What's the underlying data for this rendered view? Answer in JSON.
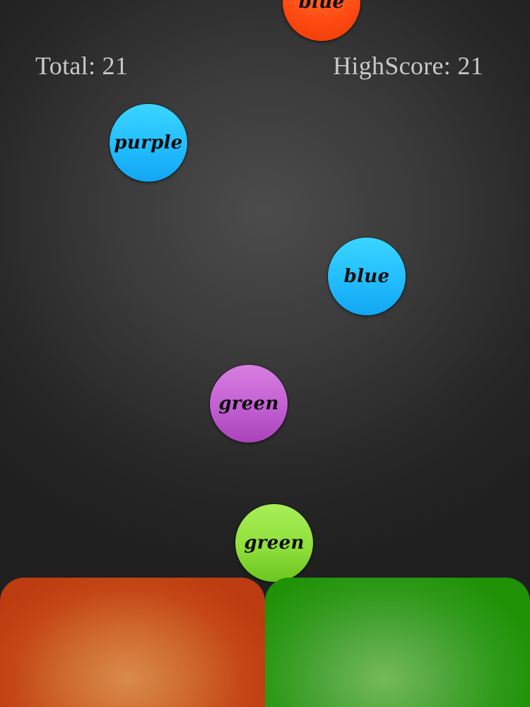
{
  "hud": {
    "total_label": "Total: 21",
    "highscore_label": "HighScore: 21",
    "total": 21,
    "highscore": 21
  },
  "balls": [
    {
      "label": "blue",
      "color": "#ff5a1e"
    },
    {
      "label": "purple",
      "color": "#22bdff"
    },
    {
      "label": "blue",
      "color": "#22bdff"
    },
    {
      "label": "green",
      "color": "#c25fd2"
    },
    {
      "label": "green",
      "color": "#8fe03c"
    }
  ],
  "bins": [
    {
      "name": "orange-bin",
      "color": "#c94a1a"
    },
    {
      "name": "green-bin",
      "color": "#2a9a12"
    }
  ]
}
